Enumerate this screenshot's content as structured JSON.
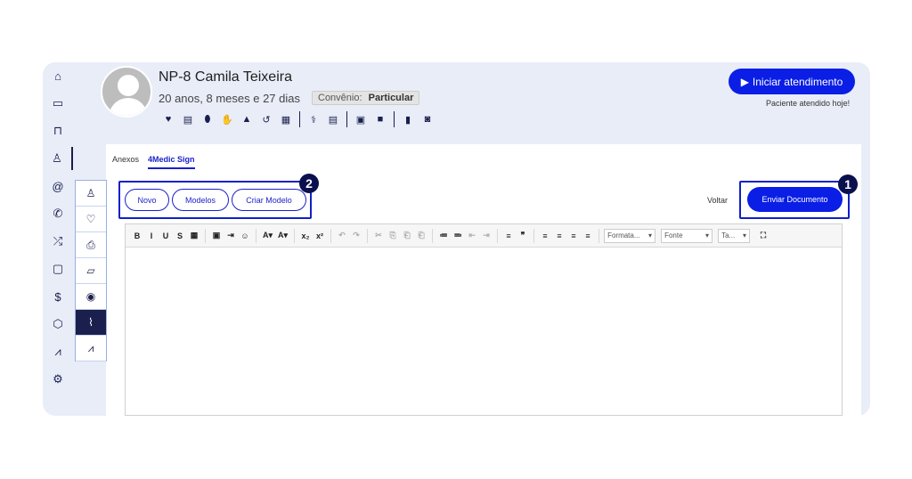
{
  "sidebar": {
    "items": [
      {
        "icon": "home-icon",
        "glyph": "⌂"
      },
      {
        "icon": "calendar-icon",
        "glyph": "▭"
      },
      {
        "icon": "sofa-icon",
        "glyph": "⊓"
      },
      {
        "icon": "user-icon",
        "glyph": "♙"
      },
      {
        "icon": "at-icon",
        "glyph": "@"
      },
      {
        "icon": "phone-icon",
        "glyph": "✆"
      },
      {
        "icon": "shuffle-icon",
        "glyph": "⤮"
      },
      {
        "icon": "clipboard-icon",
        "glyph": "▢"
      },
      {
        "icon": "dollar-icon",
        "glyph": "$"
      },
      {
        "icon": "box-icon",
        "glyph": "⬡"
      },
      {
        "icon": "chart-icon",
        "glyph": "⩘"
      },
      {
        "icon": "gear-icon",
        "glyph": "⚙"
      }
    ]
  },
  "patient": {
    "id": "NP-8",
    "name": "Camila Teixeira",
    "age": "20 anos, 8 meses e 27 dias",
    "convenio_label": "Convênio:",
    "convenio_value": "Particular"
  },
  "iconbar": [
    {
      "icon": "heartbeat-icon",
      "glyph": "♥"
    },
    {
      "icon": "clipboard-icon",
      "glyph": "▤"
    },
    {
      "icon": "pill-icon",
      "glyph": "⬮"
    },
    {
      "icon": "hand-icon",
      "glyph": "✋"
    },
    {
      "icon": "warning-icon",
      "glyph": "▲"
    },
    {
      "icon": "history-icon",
      "glyph": "↺"
    },
    {
      "icon": "table-icon",
      "glyph": "▦"
    },
    {
      "sep": true
    },
    {
      "icon": "stethoscope-icon",
      "glyph": "⚕"
    },
    {
      "icon": "list-icon",
      "glyph": "▤"
    },
    {
      "sep": true
    },
    {
      "icon": "calendar-check-icon",
      "glyph": "▣"
    },
    {
      "icon": "video-icon",
      "glyph": "■"
    },
    {
      "sep": true
    },
    {
      "icon": "book-icon",
      "glyph": "▮"
    },
    {
      "icon": "robot-icon",
      "glyph": "◙"
    }
  ],
  "actions": {
    "start_label": "Iniciar atendimento",
    "attended_note": "Paciente atendido hoje!"
  },
  "tabs": [
    {
      "label": "Anexos",
      "active": false
    },
    {
      "label": "4Medic Sign",
      "active": true
    }
  ],
  "subnav": [
    {
      "icon": "user-icon",
      "glyph": "♙",
      "active": false
    },
    {
      "icon": "heartbeat-icon",
      "glyph": "♡",
      "active": false
    },
    {
      "icon": "printer-icon",
      "glyph": "⎙",
      "active": false
    },
    {
      "icon": "folder-icon",
      "glyph": "▱",
      "active": false
    },
    {
      "icon": "camera-icon",
      "glyph": "◉",
      "active": false
    },
    {
      "icon": "paperclip-icon",
      "glyph": "⌇",
      "active": true
    },
    {
      "icon": "chart-icon",
      "glyph": "⩘",
      "active": false
    }
  ],
  "doc": {
    "novo": "Novo",
    "modelos": "Modelos",
    "criar_modelo": "Criar Modelo",
    "voltar": "Voltar",
    "enviar": "Enviar Documento"
  },
  "badges": {
    "one": "1",
    "two": "2"
  },
  "toolbar": {
    "buttons1": [
      "B",
      "I",
      "U",
      "S",
      "▦"
    ],
    "buttons2": [
      "▣",
      "⇥",
      "☺"
    ],
    "buttons3": [
      "A▾",
      "A▾"
    ],
    "buttons4": [
      "x₂",
      "x²"
    ],
    "buttons5": [
      "↶",
      "↷"
    ],
    "buttons6": [
      "✂",
      "⎘",
      "⎗",
      "⎗"
    ],
    "buttons7": [
      "≔",
      "≕",
      "⇤",
      "⇥"
    ],
    "buttons8": [
      "≡",
      "❞"
    ],
    "buttons9": [
      "≡",
      "≡",
      "≡",
      "≡"
    ],
    "format_label": "Formata...",
    "font_label": "Fonte",
    "size_label": "Ta...",
    "fullscreen": "⛶"
  }
}
